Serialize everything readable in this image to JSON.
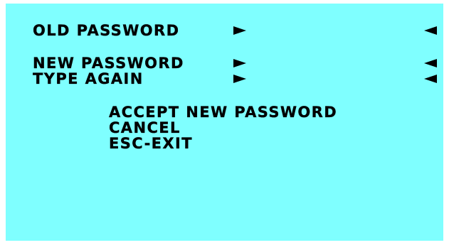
{
  "menu": {
    "old_password_label": "OLD PASSWORD",
    "new_password_label": "NEW PASSWORD",
    "type_again_label": "TYPE AGAIN",
    "options": [
      "ACCEPT NEW PASSWORD",
      "CANCEL",
      "ESC-EXIT"
    ]
  },
  "icons": {
    "field_start": "arrow-right-icon",
    "field_end": "arrow-left-icon"
  },
  "colors": {
    "screen_background": "#7fffff",
    "text": "#000000"
  }
}
